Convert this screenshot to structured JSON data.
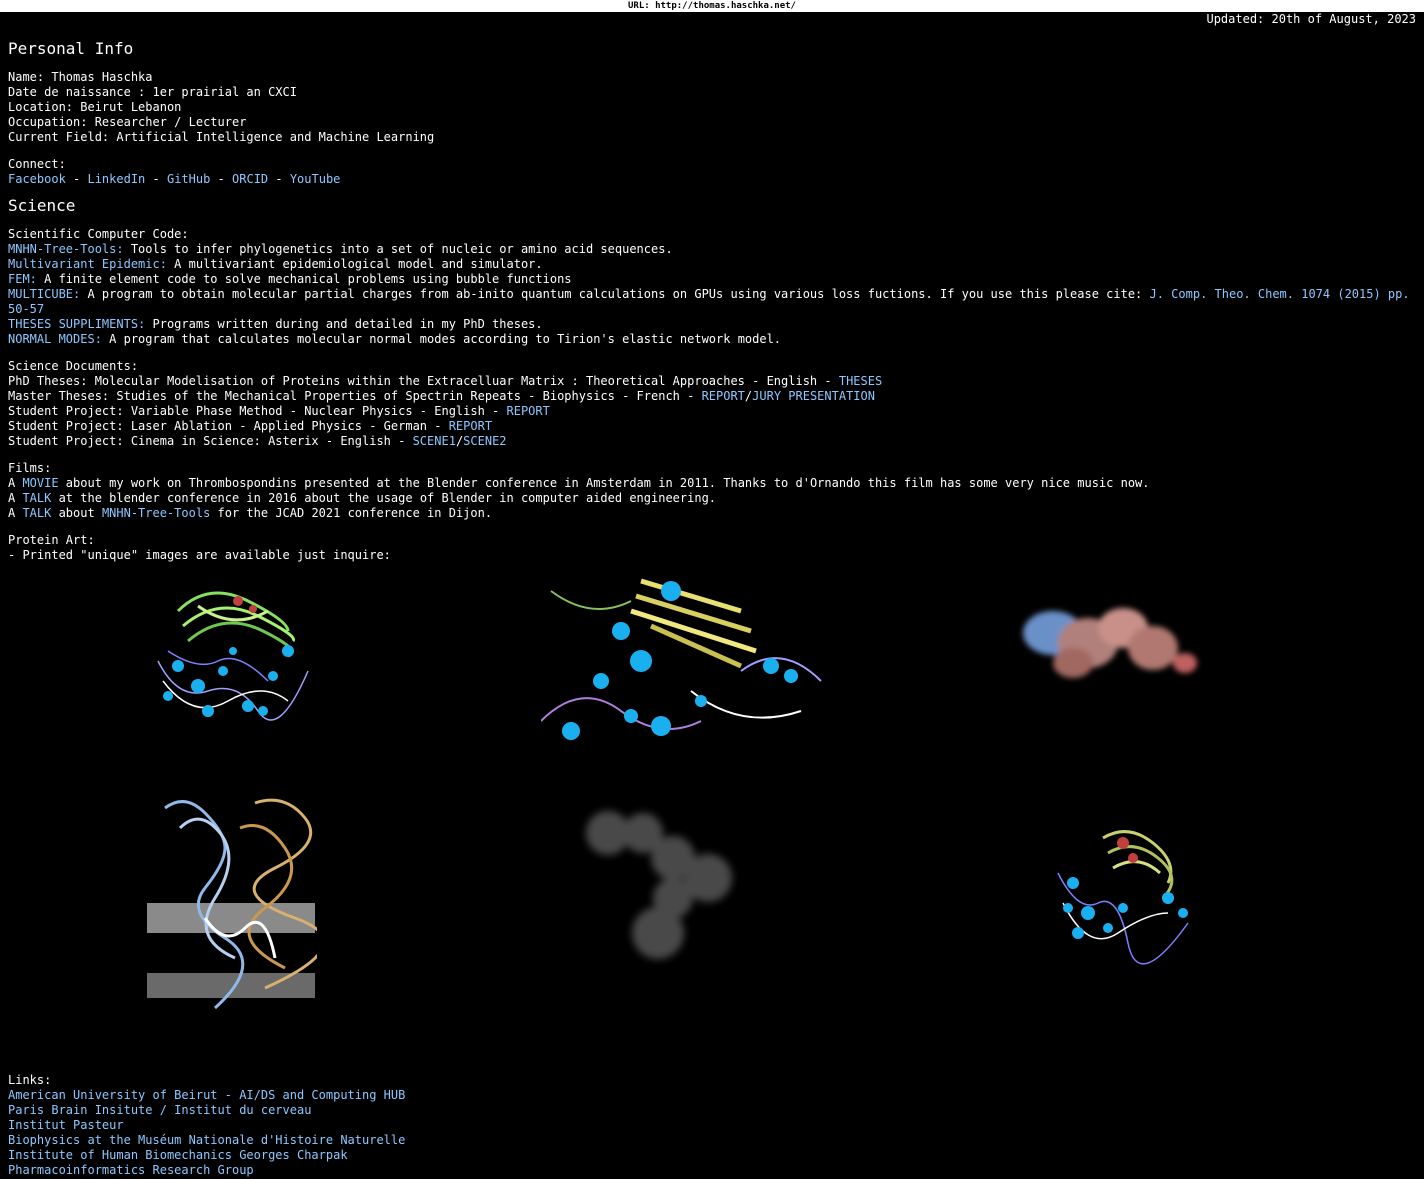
{
  "url_bar": "URL: http://thomas.haschka.net/",
  "updated": "Updated: 20th of August, 2023",
  "personal": {
    "heading": "Personal Info",
    "lines": [
      "Name: Thomas Haschka",
      "Date de naissance : 1er prairial an CXCI",
      "Location: Beirut Lebanon",
      "Occupation: Researcher / Lecturer",
      "Current Field: Artificial Intelligence and Machine Learning"
    ],
    "connect_label": "Connect:",
    "connect_links": [
      "Facebook",
      "LinkedIn",
      "GitHub",
      "ORCID",
      "YouTube"
    ],
    "sep": " - "
  },
  "science": {
    "heading": "Science",
    "code_label": "Scientific Computer Code:",
    "code": [
      {
        "name": "MNHN-Tree-Tools:",
        "desc": " Tools to infer phylogenetics into a set of nucleic or amino acid sequences."
      },
      {
        "name": "Multivariant Epidemic:",
        "desc": " A multivariant epidemiological model and simulator."
      },
      {
        "name": "FEM:",
        "desc": " A finite element code to solve mechanical problems using bubble functions"
      },
      {
        "name": "MULTICUBE:",
        "desc": " A program to obtain molecular partial charges from ab-inito quantum calculations on GPUs using various loss fuctions. If you use this please cite: ",
        "cite": "J. Comp. Theo. Chem. 1074 (2015) pp. 50-57"
      },
      {
        "name": "THESES SUPPLIMENTS:",
        "desc": " Programs written during and detailed in my PhD theses."
      },
      {
        "name": "NORMAL MODES:",
        "desc": " A program that calculates molecular normal modes according to Tirion's elastic network model."
      }
    ],
    "docs_label": "Science Documents:",
    "docs": {
      "phd_text": "PhD Theses: Molecular Modelisation of Proteins within the Extracelluar Matrix : Theoretical Approaches - English - ",
      "phd_link": "THESES",
      "master_text": "Master Theses: Studies of the Mechanical Properties of Spectrin Repeats - Biophysics - French - ",
      "master_link1": "REPORT",
      "slash": "/",
      "master_link2": "JURY PRESENTATION",
      "vpm_text": "Student Project: Variable Phase Method - Nuclear Physics - English - ",
      "vpm_link": "REPORT",
      "laser_text": "Student Project: Laser Ablation - Applied Physics - German - ",
      "laser_link": "REPORT",
      "cinema_text": "Student Project: Cinema in Science: Asterix - English - ",
      "cinema_link1": "SCENE1",
      "cinema_link2": "SCENE2"
    },
    "films_label": "Films:",
    "films": {
      "a": "A ",
      "f1_link": "MOVIE",
      "f1_text": " about my work on Thrombospondins presented at the Blender conference in Amsterdam in 2011. Thanks to d'Ornando this film has some very nice music now.",
      "f2_link": "TALK",
      "f2_text": " at the blender conference in 2016 about the usage of Blender in computer aided engineering.",
      "f3_link": "TALK",
      "f3_mid": " about ",
      "f3_link2": "MNHN-Tree-Tools",
      "f3_text": " for the JCAD 2021 conference in Dijon."
    },
    "art_label": "Protein Art:",
    "art_note": "- Printed \"unique\" images are available just inquire:"
  },
  "links": {
    "label": "Links:",
    "items": [
      "American University of Beirut - AI/DS and Computing HUB",
      "Paris Brain Insitute / Institut du cerveau",
      "Institut Pasteur",
      "Biophysics at the Muséum Nationale d'Histoire Naturelle",
      "Institute of Human Biomechanics Georges Charpak",
      "Pharmacoinformatics Research Group"
    ]
  },
  "colors": {
    "background": "#000000",
    "text": "#ffffff",
    "link": "#8cc8ff"
  }
}
